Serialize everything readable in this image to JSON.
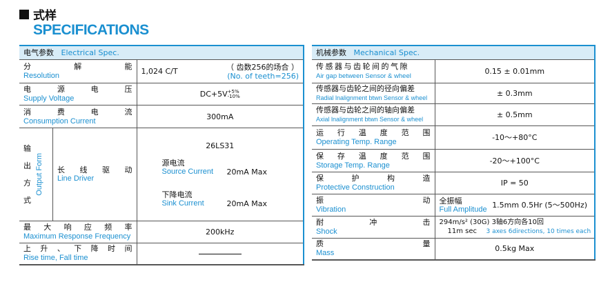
{
  "header": {
    "title_zh": "式样",
    "title_en": "SPECIFICATIONS"
  },
  "electrical": {
    "heading_zh": "电气参数",
    "heading_en": "Electrical Spec.",
    "resolution": {
      "zh": [
        "分",
        "解",
        "能"
      ],
      "en": "Resolution",
      "value": "1,024 C/T",
      "note_zh": "（ 齿数256的场合 ）",
      "note_en": "(No. of teeth=256)"
    },
    "supply": {
      "zh": [
        "电",
        "源",
        "电",
        "压"
      ],
      "en": "Supply Voltage",
      "value": "DC+5V",
      "tol_plus": "+5%",
      "tol_minus": "-10%"
    },
    "consumption": {
      "zh": [
        "消",
        "费",
        "电",
        "流"
      ],
      "en": "Consumption Current",
      "value": "300mA"
    },
    "output": {
      "zh": [
        "输",
        "出",
        "方",
        "式"
      ],
      "en": "Output Form",
      "type_zh": [
        "长",
        "线",
        "驱",
        "动"
      ],
      "type_en": "Line Driver",
      "chip": "26LS31",
      "source_zh": "源电流",
      "source_en": "Source Current",
      "source_val": "20mA Max",
      "sink_zh": "下降电流",
      "sink_en": "Sink Current",
      "sink_val": "20mA Max"
    },
    "max_freq": {
      "zh": [
        "最",
        "大",
        "响",
        "应",
        "频",
        "率"
      ],
      "en": "Maximum Response Frequency",
      "value": "200kHz"
    },
    "rise": {
      "zh": [
        "上",
        "升",
        "、",
        "下",
        "降",
        "时",
        "间"
      ],
      "en": "Rise time, Fall time"
    }
  },
  "mechanical": {
    "heading_zh": "机械参数",
    "heading_en": "Mechanical Spec.",
    "air_gap": {
      "zh": "传感器与齿轮间的气隙",
      "en": "Air gap between Sensor & wheel",
      "value": "0.15 ± 0.01mm"
    },
    "radial": {
      "zh": "传感器与齿轮之间的径向偏差",
      "en": "Radial lnalignment btwn Sensor & wheel",
      "value": "± 0.3mm"
    },
    "axial": {
      "zh": "传感器与齿轮之间的轴向偏差",
      "en": "Axial lnalignment btwn Sensor & wheel",
      "value": "± 0.5mm"
    },
    "op_temp": {
      "zh": [
        "运",
        "行",
        "温",
        "度",
        "范",
        "围"
      ],
      "en": "Operating Temp. Range",
      "value": "-10～+80°C"
    },
    "st_temp": {
      "zh": [
        "保",
        "存",
        "温",
        "度",
        "范",
        "围"
      ],
      "en": "Storage Temp. Range",
      "value": "-20～+100°C"
    },
    "protection": {
      "zh": [
        "保",
        "护",
        "构",
        "造"
      ],
      "en": "Protective Construction",
      "value": "IP = 50"
    },
    "vibration": {
      "zh": [
        "振",
        "动"
      ],
      "en": "Vibration",
      "amp_zh": "全振幅",
      "amp_en": "Full Amplitude",
      "value": "1.5mm  0.5Hr (5～500Hz)"
    },
    "shock": {
      "zh": [
        "耐",
        "冲",
        "击"
      ],
      "en": "Shock",
      "line1a": "294m/s² (30G)",
      "line1b": "3轴6方向各10回",
      "line2a": "11m sec",
      "line2b": "3 axes 6directions, 10 times each"
    },
    "mass": {
      "zh": [
        "质",
        "量"
      ],
      "en": "Mass",
      "value": "0.5kg Max"
    }
  },
  "colors": {
    "accent": "#1a8fd0",
    "header_bg": "#d8ecf7"
  }
}
